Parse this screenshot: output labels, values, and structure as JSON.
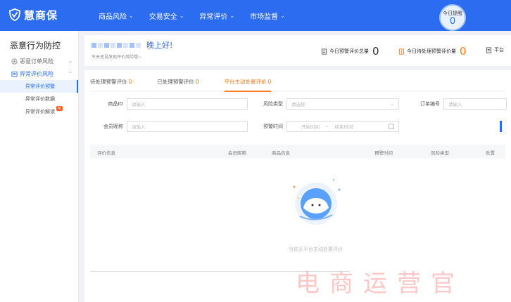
{
  "app": {
    "logo_text": "慧商保",
    "brand_color": "#2b6cf0",
    "accent_color": "#ff7a1a"
  },
  "nav": {
    "items": [
      {
        "label": "商品风险"
      },
      {
        "label": "交易安全"
      },
      {
        "label": "异常评价"
      },
      {
        "label": "市场监督"
      }
    ]
  },
  "warning_bubble": {
    "label": "今日提醒",
    "count": "0"
  },
  "sidebar": {
    "title": "恶意行为防控",
    "groups": [
      {
        "label": "恶意订单风险",
        "icon": "target-icon"
      },
      {
        "label": "异常评价风险",
        "icon": "list-icon",
        "sub": [
          "异常评价预警",
          "异常评价数据",
          "异常评价解读"
        ]
      }
    ],
    "new_badge": "N"
  },
  "header": {
    "greeting": "晚上好!",
    "subtext": "今天还没发现评价风险哦~",
    "stats": [
      {
        "label": "今日预警评价总量",
        "value": "0"
      },
      {
        "label": "今日待处理预警评价量",
        "value": "0"
      },
      {
        "label": "平台"
      }
    ]
  },
  "tabs": [
    {
      "label": "待处理预警评价",
      "count": "0"
    },
    {
      "label": "已处理预警评价",
      "count": "0"
    },
    {
      "label": "平台主动处置评价",
      "count": "0"
    }
  ],
  "filters": {
    "product_id": {
      "label": "商品ID",
      "placeholder": "请输入"
    },
    "risk_type": {
      "label": "风险类型",
      "placeholder": "请选择"
    },
    "order_no": {
      "label": "订单编号",
      "placeholder": "请输入"
    },
    "member_nick": {
      "label": "会员昵称",
      "placeholder": "请输入"
    },
    "warn_time": {
      "label": "预警时间",
      "start": "开始时间",
      "end": "结束时间"
    }
  },
  "table": {
    "headers": [
      "评价信息",
      "会员昵称",
      "商品信息",
      "预警时间",
      "风险类型",
      "处置"
    ]
  },
  "empty_text": "当前无平台主动处置评价",
  "watermark": "电商运营官"
}
